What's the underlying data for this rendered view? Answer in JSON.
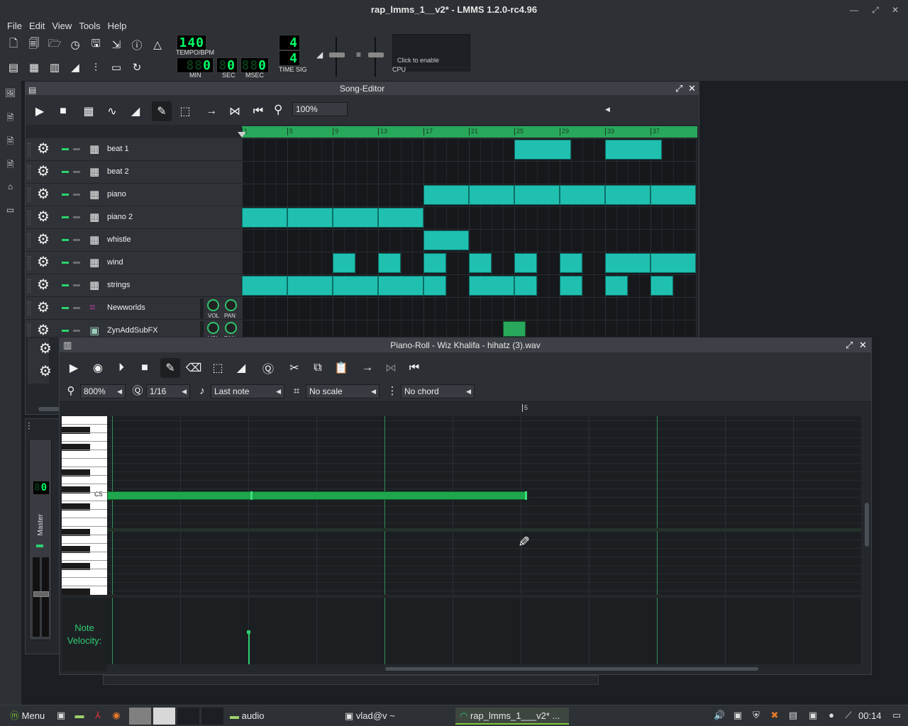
{
  "window": {
    "title": "rap_lmms_1__v2* - LMMS 1.2.0-rc4.96"
  },
  "menu": [
    "File",
    "Edit",
    "View",
    "Tools",
    "Help"
  ],
  "transport": {
    "tempo": "140",
    "tempo_label": "TEMPO/BPM",
    "min": "0",
    "min_label": "MIN",
    "sec": "0",
    "sec_label": "SEC",
    "msec": "0",
    "msec_label": "MSEC",
    "timesig_num": "4",
    "timesig_den": "4",
    "timesig_label": "TIME SIG",
    "cpu_hint": "Click to enable",
    "cpu_label": "CPU"
  },
  "song_editor": {
    "title": "Song-Editor",
    "zoom": "100%",
    "bar_labels": [
      "1",
      "5",
      "9",
      "13",
      "17",
      "21",
      "25",
      "29",
      "33",
      "37"
    ],
    "tracks": [
      {
        "name": "beat 1",
        "type": "bb"
      },
      {
        "name": "beat 2",
        "type": "bb"
      },
      {
        "name": "piano",
        "type": "bb"
      },
      {
        "name": "piano 2",
        "type": "bb"
      },
      {
        "name": "whistle",
        "type": "bb"
      },
      {
        "name": "wind",
        "type": "bb"
      },
      {
        "name": "strings",
        "type": "bb"
      },
      {
        "name": "Newworlds",
        "type": "instrument"
      },
      {
        "name": "ZynAddSubFX",
        "type": "instrument"
      }
    ],
    "vol_label": "VOL",
    "pan_label": "PAN"
  },
  "mixer": {
    "master_label": "Master",
    "value": "0"
  },
  "piano_roll": {
    "title": "Piano-Roll - Wiz Khalifa - hihatz (3).wav",
    "zoom": "800%",
    "quantize": "1/16",
    "note_length": "Last note",
    "scale": "No scale",
    "chord": "No chord",
    "bar_marker": "5",
    "key_label": "C5",
    "velocity_label_1": "Note",
    "velocity_label_2": "Velocity:"
  },
  "taskbar": {
    "menu": "Menu",
    "tasks": [
      "audio",
      "vlad@v ~",
      "rap_lmms_1___v2* ..."
    ],
    "clock": "00:14"
  },
  "colors": {
    "accent": "#2ecc71",
    "pattern": "#20c0b0",
    "note": "#1fa64e"
  }
}
